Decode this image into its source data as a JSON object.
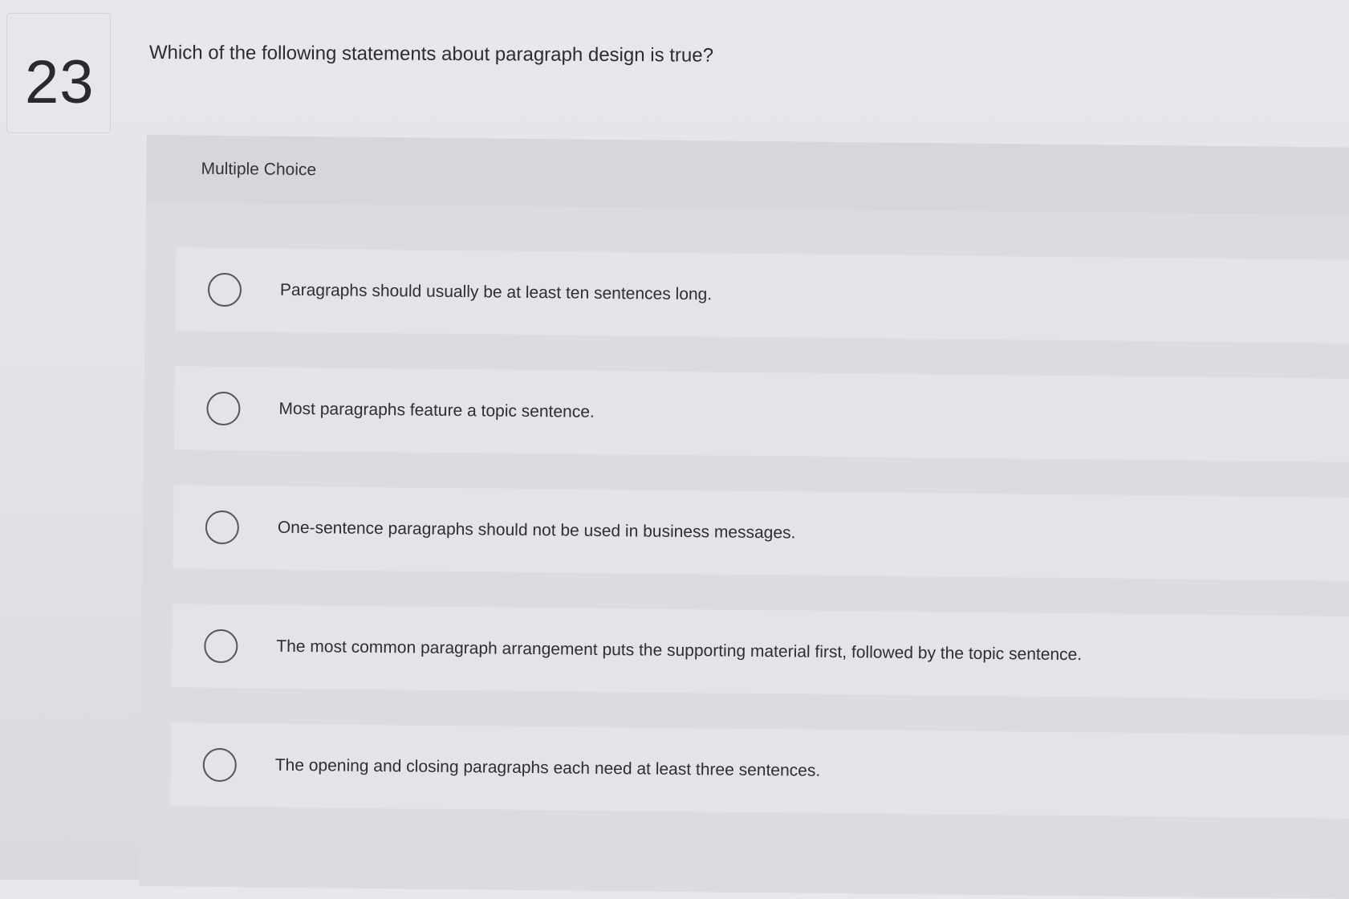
{
  "question": {
    "number": "23",
    "text": "Which of the following statements about paragraph design is true?"
  },
  "answer_section": {
    "type_label": "Multiple Choice",
    "choices": [
      {
        "label": "Paragraphs should usually be at least ten sentences long.",
        "selected": false
      },
      {
        "label": "Most paragraphs feature a topic sentence.",
        "selected": false
      },
      {
        "label": "One-sentence paragraphs should not be used in business messages.",
        "selected": false
      },
      {
        "label": "The most common paragraph arrangement puts the supporting material first, followed by the topic sentence.",
        "selected": false
      },
      {
        "label": "The opening and closing paragraphs each need at least three sentences.",
        "selected": false
      }
    ]
  },
  "colors": {
    "background": "#e6e2ea",
    "panel": "#dedae2",
    "choice_row": "#e6e2ea",
    "text": "#2c2c30",
    "radio_border": "#55555a"
  },
  "icons": {
    "radio": "radio-button-unchecked-icon"
  }
}
